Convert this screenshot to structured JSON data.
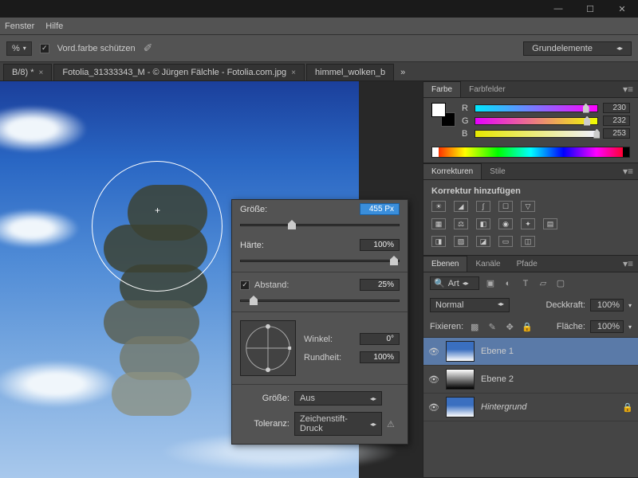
{
  "menu": {
    "fenster": "Fenster",
    "hilfe": "Hilfe"
  },
  "optbar": {
    "pct": "%",
    "vordfarbe": "Vord.farbe schützen",
    "workspace": "Grundelemente"
  },
  "tabs": {
    "t1": "B/8) *",
    "t2": "Fotolia_31333343_M - © Jürgen Fälchle - Fotolia.com.jpg",
    "t3": "himmel_wolken_b"
  },
  "brush": {
    "groesse_lbl": "Größe:",
    "groesse_val": "455 Px",
    "haerte_lbl": "Härte:",
    "haerte_val": "100%",
    "abstand_lbl": "Abstand:",
    "abstand_val": "25%",
    "winkel_lbl": "Winkel:",
    "winkel_val": "0°",
    "rundheit_lbl": "Rundheit:",
    "rundheit_val": "100%",
    "groesse2_lbl": "Größe:",
    "groesse2_val": "Aus",
    "toleranz_lbl": "Toleranz:",
    "toleranz_val": "Zeichenstift-Druck"
  },
  "farbe": {
    "tab1": "Farbe",
    "tab2": "Farbfelder",
    "r": "R",
    "g": "G",
    "b": "B",
    "rv": "230",
    "gv": "232",
    "bv": "253"
  },
  "korrekturen": {
    "tab1": "Korrekturen",
    "tab2": "Stile",
    "title": "Korrektur hinzufügen"
  },
  "ebenen": {
    "tab1": "Ebenen",
    "tab2": "Kanäle",
    "tab3": "Pfade",
    "filter": "Art",
    "mode": "Normal",
    "deckkraft_lbl": "Deckkraft:",
    "deckkraft_val": "100%",
    "fixieren_lbl": "Fixieren:",
    "flaeche_lbl": "Fläche:",
    "flaeche_val": "100%",
    "l1": "Ebene 1",
    "l2": "Ebene 2",
    "l3": "Hintergrund"
  }
}
